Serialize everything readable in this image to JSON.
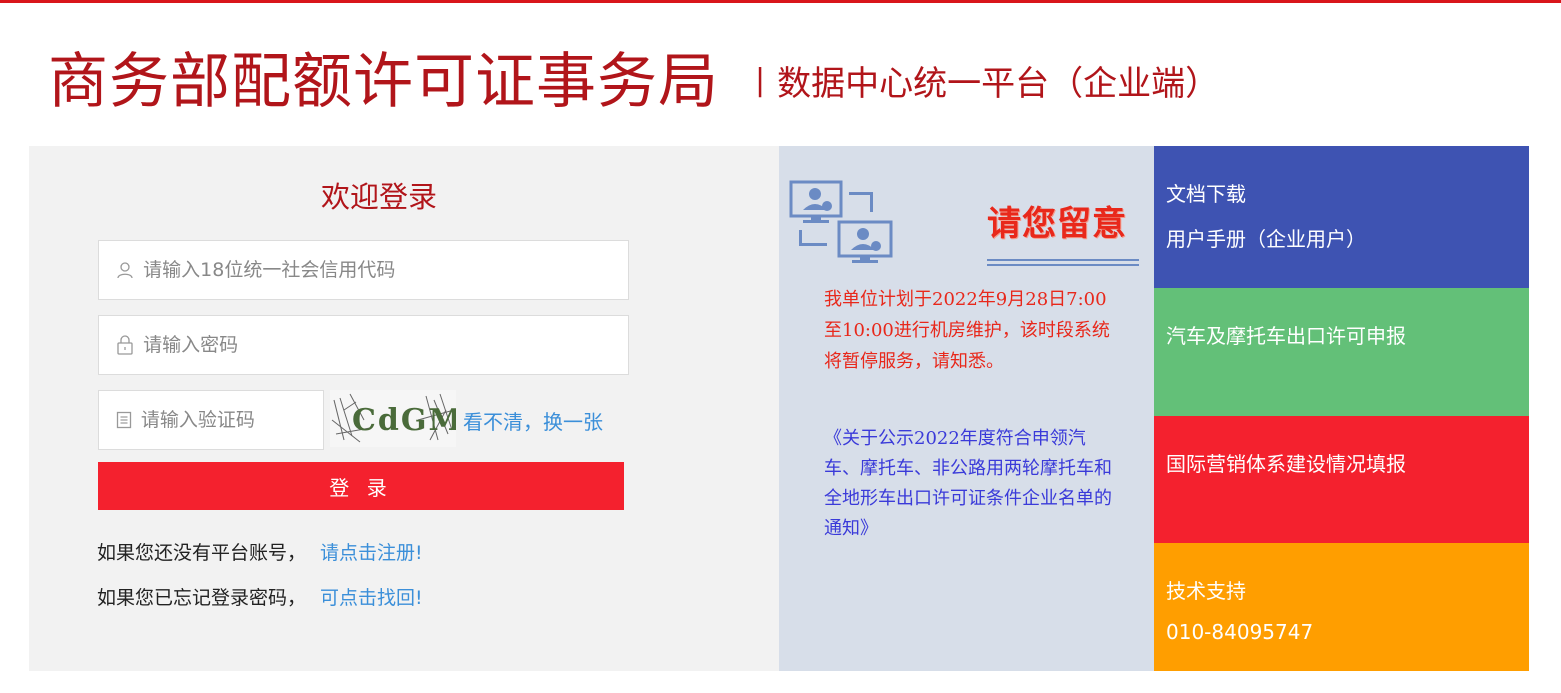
{
  "header": {
    "title": "商务部配额许可证事务局",
    "separator": "|",
    "subtitle": "数据中心统一平台（企业端）"
  },
  "login": {
    "welcome": "欢迎登录",
    "credit_code_placeholder": "请输入18位统一社会信用代码",
    "password_placeholder": "请输入密码",
    "captcha_placeholder": "请输入验证码",
    "captcha_text": "CdGM",
    "refresh_captcha": "看不清，换一张",
    "login_button": "登 录",
    "register_prompt": "如果您还没有平台账号，",
    "register_link": "请点击注册!",
    "forgot_prompt": "如果您已忘记登录密码，",
    "forgot_link": "可点击找回!"
  },
  "notice": {
    "title": "请您留意",
    "maintenance_text": "我单位计划于2022年9月28日7:00至10:00进行机房维护，该时段系统将暂停服务，请知悉。",
    "announcement_link": "《关于公示2022年度符合申领汽车、摩托车、非公路用两轮摩托车和全地形车出口许可证条件企业名单的通知》"
  },
  "tiles": {
    "docs_title": "文档下载",
    "docs_manual": "用户手册（企业用户）",
    "vehicle_export": "汽车及摩托车出口许可申报",
    "marketing_system": "国际营销体系建设情况填报",
    "support_title": "技术支持",
    "support_phone": "010-84095747"
  },
  "colors": {
    "brand_red": "#b1151a",
    "button_red": "#f4212e",
    "link_blue": "#3b8fd9",
    "tile_blue": "#3e53b2",
    "tile_green": "#63c078",
    "tile_red": "#f4212e",
    "tile_orange": "#ff9e00",
    "notice_bg": "#d7dee9"
  },
  "icons": {
    "credit_code_field": "user-icon",
    "password_field": "lock-icon",
    "captcha_field": "document-icon",
    "notice_illustration": "monitor-users-icon"
  }
}
